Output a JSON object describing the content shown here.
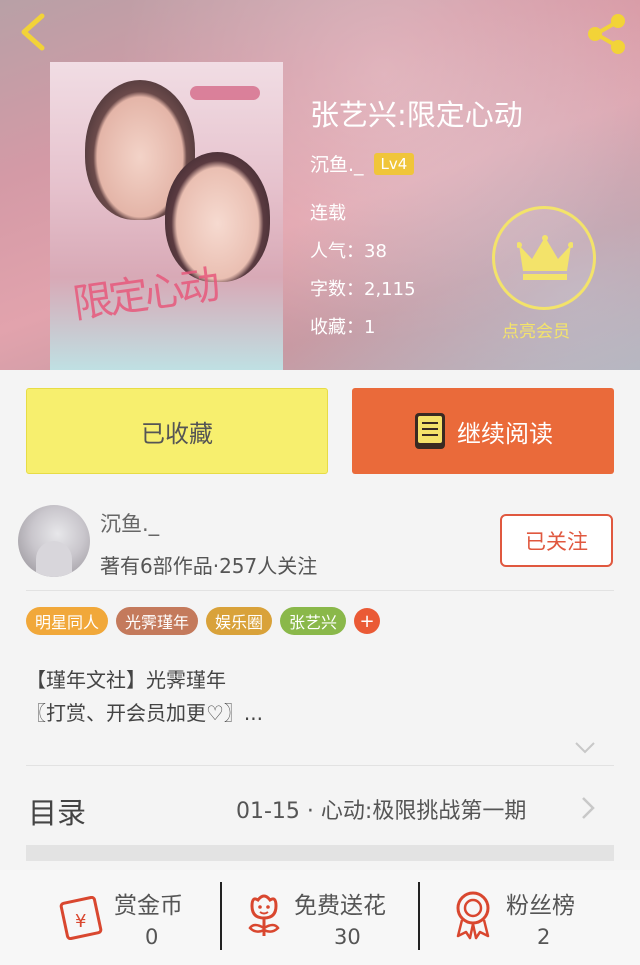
{
  "header": {
    "book_title": "张艺兴:限定心动",
    "author_name": "沉鱼._",
    "level": "Lv4",
    "status": "连载",
    "popularity": "人气：38",
    "words": "字数：2,115",
    "favorites": "收藏：1",
    "vip_label": "点亮会员"
  },
  "cover": {
    "art_text": "限定心动"
  },
  "actions": {
    "favorite_label": "已收藏",
    "read_label": "继续阅读"
  },
  "author": {
    "name": "沉鱼._",
    "stats": "著有6部作品·257人关注",
    "follow_label": "已关注"
  },
  "tags": [
    {
      "label": "明星同人",
      "color": "#f1a83a"
    },
    {
      "label": "光霁瑾年",
      "color": "#c47a5c"
    },
    {
      "label": "娱乐圈",
      "color": "#d9a23a"
    },
    {
      "label": "张艺兴",
      "color": "#8ab84a"
    }
  ],
  "tag_more": "+",
  "intro": {
    "line1": "【瑾年文社】光霁瑾年",
    "line2": "〖打赏、开会员加更♡〗..."
  },
  "catalog": {
    "title": "目录",
    "latest": "01-15 · 心动:极限挑战第一期"
  },
  "bottom": {
    "reward_label": "赏金币",
    "reward_count": "0",
    "flower_label": "免费送花",
    "flower_count": "30",
    "fans_label": "粉丝榜",
    "fans_count": "2"
  },
  "colors": {
    "accent_orange": "#ea6a3a",
    "fav_yellow": "#f7ef6e",
    "follow_red": "#e0583f",
    "vip_yellow": "#f3e36a"
  }
}
